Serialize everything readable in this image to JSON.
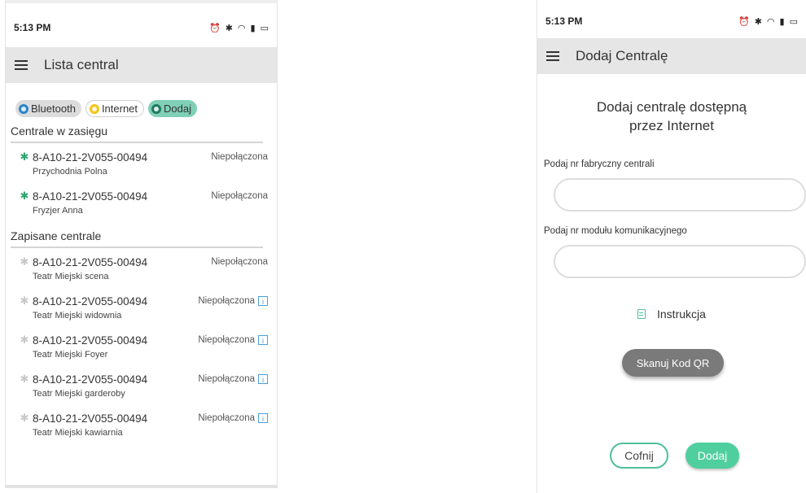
{
  "left_screen": {
    "status_time": "5:13 PM",
    "status_icons": [
      "alarm-icon",
      "bluetooth-icon",
      "wifi-icon",
      "signal-icon",
      "battery-icon"
    ],
    "title": "Lista central",
    "chips": [
      {
        "label": "Bluetooth",
        "color": "#2a86c9"
      },
      {
        "label": "Internet",
        "color": "#f5c518"
      },
      {
        "label": "Dodaj",
        "color": "#1f7a60"
      }
    ],
    "section_range": "Centrale w zasięgu",
    "in_range": [
      {
        "code": "8-A10-21-2V055-00494",
        "name": "Przychodnia Polna",
        "state": "Niepołączona"
      },
      {
        "code": "8-A10-21-2V055-00494",
        "name": "Fryzjer Anna",
        "state": "Niepołączona"
      }
    ],
    "section_saved": "Zapisane centrale",
    "saved": [
      {
        "code": "8-A10-21-2V055-00494",
        "name": "Teatr Miejski scena",
        "state": "Niepołączona"
      },
      {
        "code": "8-A10-21-2V055-00494",
        "name": "Teatr Miejski widownia",
        "state": "Niepołączona"
      },
      {
        "code": "8-A10-21-2V055-00494",
        "name": "Teatr Miejski Foyer",
        "state": "Niepołączona"
      },
      {
        "code": "8-A10-21-2V055-00494",
        "name": "Teatr Miejski garderoby",
        "state": "Niepołączona"
      },
      {
        "code": "8-A10-21-2V055-00494",
        "name": "Teatr Miejski kawiarnia",
        "state": "Niepołączona"
      }
    ],
    "info_glyph": "i"
  },
  "right_screen": {
    "status_time": "5:13 PM",
    "title": "Dodaj Centralę",
    "heading_line1": "Dodaj centralę dostępną",
    "heading_line2": "przez Internet",
    "field1_label": "Podaj nr fabryczny centrali",
    "field1_value": "",
    "field2_label": "Podaj nr modułu komunikacyjnego",
    "field2_value": "",
    "instructions_label": "Instrukcja",
    "scan_button": "Skanuj Kod QR",
    "back_button": "Cofnij",
    "add_button": "Dodaj"
  },
  "colors": {
    "accent": "#4fcf9e",
    "appbar": "#e6e6e6",
    "bt_active": "#2ca66f",
    "info": "#4a9fdc"
  }
}
